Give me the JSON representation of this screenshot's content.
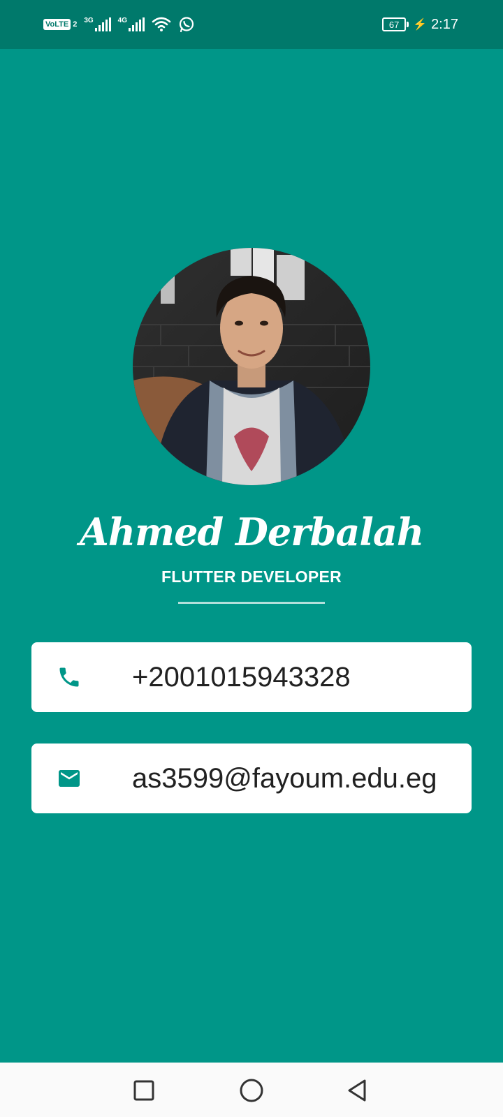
{
  "status_bar": {
    "volte_label": "VoLTE",
    "sim_label": "2",
    "network_1": "3G",
    "network_2": "4G",
    "battery_level": "67",
    "time": "2:17",
    "icons": [
      "signal-icon",
      "wifi-icon",
      "whatsapp-icon",
      "battery-icon",
      "charging-icon"
    ]
  },
  "profile": {
    "name": "Ahmed Derbalah",
    "title": "FLUTTER DEVELOPER",
    "avatar_icon": "profile-photo"
  },
  "contacts": {
    "phone": {
      "icon": "phone-icon",
      "value": "+2001015943328"
    },
    "email": {
      "icon": "mail-icon",
      "value": "as3599@fayoum.edu.eg"
    }
  },
  "navigation": {
    "icons": [
      "recent-apps-icon",
      "home-icon",
      "back-icon"
    ]
  },
  "colors": {
    "background": "#009688",
    "status_bar": "#00796b",
    "card": "#ffffff",
    "icon_accent": "#009688",
    "text_dark": "#212121",
    "divider": "#b2dfdb"
  }
}
